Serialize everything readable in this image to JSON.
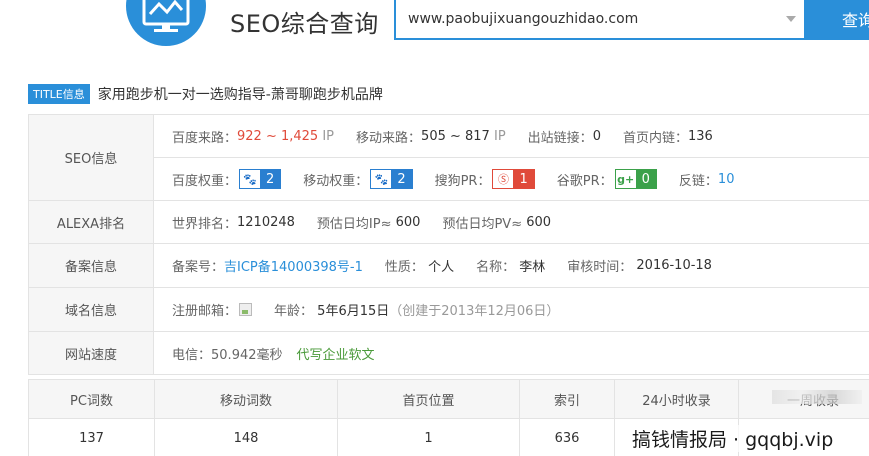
{
  "header": {
    "app_title": "SEO综合查询",
    "search_value": "www.paobujixuangouzhidao.com",
    "search_button": "查询",
    "logo_icon": "monitor-chart-icon"
  },
  "title_row": {
    "badge": "TITLE信息",
    "text": "家用跑步机一对一选购指导-萧哥聊跑步机品牌"
  },
  "seo": {
    "label": "SEO信息",
    "baidu_traffic_label": "百度来路：",
    "baidu_traffic_value": "922 ~ 1,425",
    "baidu_traffic_unit": "IP",
    "mobile_traffic_label": "移动来路：",
    "mobile_traffic_value": "505 ~ 817",
    "mobile_traffic_unit": "IP",
    "outbound_label": "出站链接：",
    "outbound_value": "0",
    "homepage_links_label": "首页内链：",
    "homepage_links_value": "136",
    "baidu_weight_label": "百度权重：",
    "baidu_weight_value": "2",
    "mobile_weight_label": "移动权重：",
    "mobile_weight_value": "2",
    "sogou_pr_label": "搜狗PR：",
    "sogou_pr_value": "1",
    "google_pr_label": "谷歌PR：",
    "google_pr_value": "0",
    "backlinks_label": "反链：",
    "backlinks_value": "10",
    "colors": {
      "blue": "#2a7fd0",
      "red": "#e04a3a",
      "green": "#3ba14a"
    }
  },
  "alexa": {
    "label": "ALEXA排名",
    "world_rank_label": "世界排名：",
    "world_rank_value": "1210248",
    "daily_ip_label": "预估日均IP≈",
    "daily_ip_value": "600",
    "daily_pv_label": "预估日均PV≈",
    "daily_pv_value": "600"
  },
  "beian": {
    "label": "备案信息",
    "number_label": "备案号：",
    "number_value": "吉ICP备14000398号-1",
    "nature_label": "性质：",
    "nature_value": "个人",
    "name_label": "名称：",
    "name_value": "李林",
    "review_label": "审核时间：",
    "review_value": "2016-10-18"
  },
  "domain": {
    "label": "域名信息",
    "email_label": "注册邮箱：",
    "age_label": "年龄：",
    "age_value": "5年6月15日",
    "created_value": "（创建于2013年12月06日）"
  },
  "speed": {
    "label": "网站速度",
    "telecom_label": "电信：",
    "telecom_value": "50.942毫秒",
    "ad_link": "代写企业软文"
  },
  "stats": {
    "headers": [
      "PC词数",
      "移动词数",
      "首页位置",
      "索引",
      "24小时收录",
      "一周收录"
    ],
    "values": [
      "137",
      "148",
      "1",
      "636",
      "",
      ""
    ]
  },
  "watermark": "搞钱情报局 · gqqbj.vip"
}
